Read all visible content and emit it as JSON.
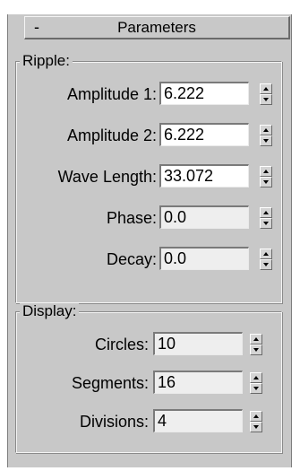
{
  "rollout": {
    "collapse_symbol": "-",
    "title": "Parameters"
  },
  "ripple": {
    "label": "Ripple:",
    "amplitude1": {
      "label": "Amplitude 1:",
      "value": "6.222"
    },
    "amplitude2": {
      "label": "Amplitude 2:",
      "value": "6.222"
    },
    "wave_length": {
      "label": "Wave Length:",
      "value": "33.072"
    },
    "phase": {
      "label": "Phase:",
      "value": "0.0"
    },
    "decay": {
      "label": "Decay:",
      "value": "0.0"
    }
  },
  "display": {
    "label": "Display:",
    "circles": {
      "label": "Circles:",
      "value": "10"
    },
    "segments": {
      "label": "Segments:",
      "value": "16"
    },
    "divisions": {
      "label": "Divisions:",
      "value": "4"
    }
  },
  "icons": {
    "spinner": "spinner-up-down-arrows-icon"
  },
  "colors": {
    "panel_background": "#c8c8c8",
    "field_background": "#ffffff",
    "field_background_gray": "#eeeeee"
  }
}
